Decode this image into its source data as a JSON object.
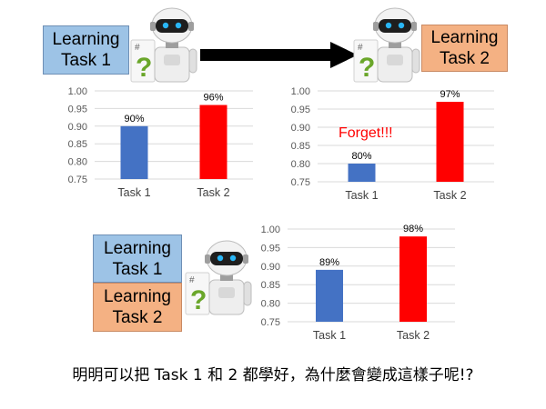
{
  "boxes": {
    "top_left": "Learning\nTask 1",
    "top_right": "Learning\nTask 2",
    "bottom_task1": "Learning\nTask 1",
    "bottom_task2": "Learning\nTask 2"
  },
  "robot_icon": "robot-icon",
  "question_mark": "?",
  "forget_text": "Forget!!!",
  "caption": "明明可以把 Task 1 和 2 都學好，為什麼會變成這樣子呢!?",
  "colors": {
    "task1": "#4472c4",
    "task2": "#ff0000",
    "forget": "#ff0000"
  },
  "chart_data": [
    {
      "type": "bar",
      "categories": [
        "Task 1",
        "Task 2"
      ],
      "values": [
        90,
        96
      ],
      "data_labels": [
        "90%",
        "96%"
      ],
      "ylim": [
        0.75,
        1.0
      ],
      "yticks": [
        "0.75",
        "0.80",
        "0.85",
        "0.90",
        "0.95",
        "1.00"
      ],
      "grid": true
    },
    {
      "type": "bar",
      "categories": [
        "Task 1",
        "Task 2"
      ],
      "values": [
        80,
        97
      ],
      "data_labels": [
        "80%",
        "97%"
      ],
      "ylim": [
        0.75,
        1.0
      ],
      "yticks": [
        "0.75",
        "0.80",
        "0.85",
        "0.90",
        "0.95",
        "1.00"
      ],
      "grid": true
    },
    {
      "type": "bar",
      "categories": [
        "Task 1",
        "Task 2"
      ],
      "values": [
        89,
        98
      ],
      "data_labels": [
        "89%",
        "98%"
      ],
      "ylim": [
        0.75,
        1.0
      ],
      "yticks": [
        "0.75",
        "0.80",
        "0.85",
        "0.90",
        "0.95",
        "1.00"
      ],
      "grid": true
    }
  ]
}
